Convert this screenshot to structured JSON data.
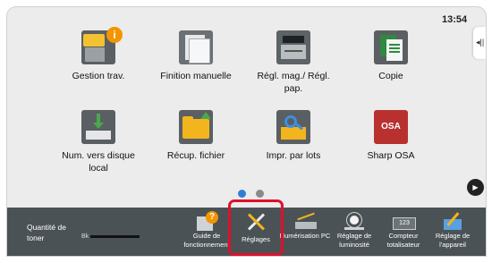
{
  "status": {
    "time": "13:54",
    "side_tab_icon": "◂||"
  },
  "apps": [
    {
      "label": "Gestion trav.",
      "icon": "job-status-icon"
    },
    {
      "label": "Finition manuelle",
      "icon": "manual-finishing-icon"
    },
    {
      "label": "Régl. mag./ Régl. pap.",
      "icon": "tray-settings-icon"
    },
    {
      "label": "Copie",
      "icon": "copy-icon"
    },
    {
      "label": "Num. vers disque local",
      "icon": "scan-to-local-drive-icon"
    },
    {
      "label": "Récup. fichier",
      "icon": "retrieve-file-icon"
    },
    {
      "label": "Impr. par lots",
      "icon": "batch-print-icon"
    },
    {
      "label": "Sharp OSA",
      "icon": "sharp-osa-icon"
    }
  ],
  "pager": {
    "current_page": 1,
    "total_pages": 2,
    "next_symbol": "▶"
  },
  "toner": {
    "label": "Quantité de toner",
    "color_letter": "Bk",
    "level": 0.0
  },
  "functions": [
    {
      "label": "Guide de fonctionnement",
      "icon": "operation-guide-icon"
    },
    {
      "label": "Réglages",
      "icon": "settings-icon",
      "selected": true
    },
    {
      "label": "Numérisation PC",
      "icon": "pc-scan-icon"
    },
    {
      "label": "Réglage de luminosité",
      "icon": "brightness-icon"
    },
    {
      "label": "Compteur totalisateur",
      "icon": "total-count-icon"
    },
    {
      "label": "Réglage de l'appareil",
      "icon": "device-settings-icon"
    }
  ]
}
